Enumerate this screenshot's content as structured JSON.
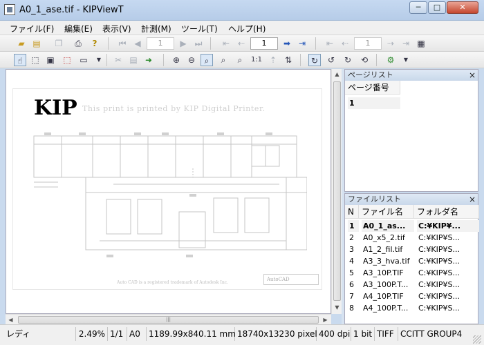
{
  "window": {
    "title": "A0_1_ase.tif - KIPViewT",
    "minimize_glyph": "─",
    "maximize_glyph": "□",
    "close_glyph": "✕"
  },
  "menu": [
    "ファイル(F)",
    "編集(E)",
    "表示(V)",
    "計測(M)",
    "ツール(T)",
    "ヘルプ(H)"
  ],
  "toolbar": {
    "page_current": "1",
    "page_input": "1",
    "page_range_right": "1"
  },
  "document": {
    "logo": "KIP",
    "notice": "This print is printed by KIP Digital Printer.",
    "footer": "Auto CAD is a registered trademark of Autodesk Inc.",
    "brand": "AutoCAD"
  },
  "page_list": {
    "title": "ページリスト",
    "close": "×",
    "column": "ページ番号",
    "rows": [
      "1"
    ]
  },
  "file_list": {
    "title": "ファイルリスト",
    "close": "×",
    "columns": [
      "N",
      "ファイル名",
      "フォルダ名"
    ],
    "rows": [
      {
        "n": "1",
        "name": "A0_1_as...",
        "folder": "C:¥KIP¥..."
      },
      {
        "n": "2",
        "name": "A0_x5_2.tif",
        "folder": "C:¥KIP¥S..."
      },
      {
        "n": "3",
        "name": "A1_2_fil.tif",
        "folder": "C:¥KIP¥S..."
      },
      {
        "n": "4",
        "name": "A3_3_hva.tif",
        "folder": "C:¥KIP¥S..."
      },
      {
        "n": "5",
        "name": "A3_10P.TIF",
        "folder": "C:¥KIP¥S..."
      },
      {
        "n": "6",
        "name": "A3_100P.T...",
        "folder": "C:¥KIP¥S..."
      },
      {
        "n": "7",
        "name": "A4_10P.TIF",
        "folder": "C:¥KIP¥S..."
      },
      {
        "n": "8",
        "name": "A4_100P.T...",
        "folder": "C:¥KIP¥S..."
      }
    ]
  },
  "status": {
    "state": "レディ",
    "zoom": "2.49%",
    "page": "1/1",
    "paper": "A0",
    "size_mm": "1189.99x840.11 mm",
    "pixels": "18740x13230 pixel",
    "dpi": "400 dpi",
    "bits": "1 bit",
    "format": "TIFF",
    "compression": "CCITT GROUP4"
  }
}
